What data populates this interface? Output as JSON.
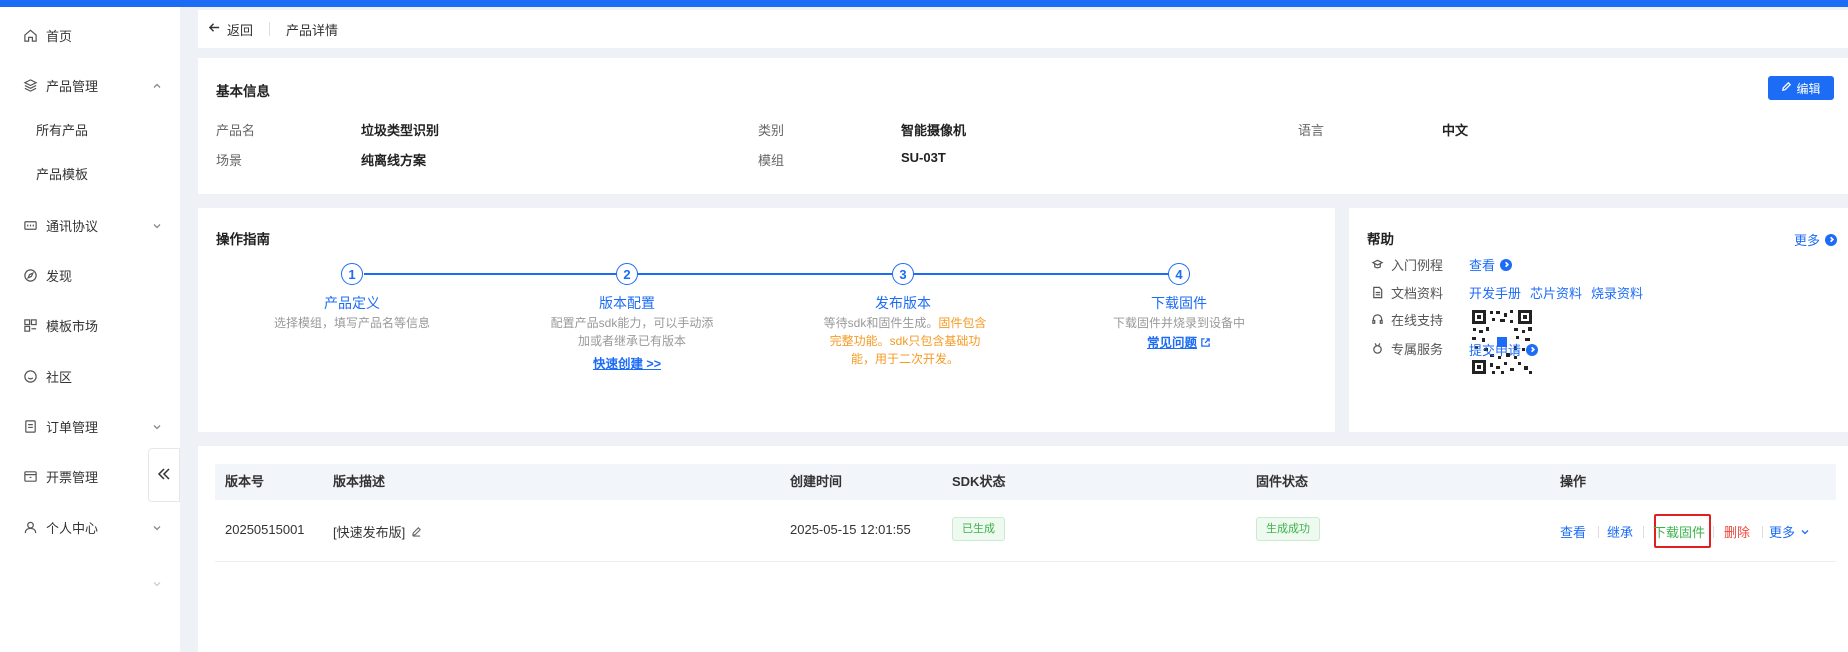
{
  "sidebar": {
    "items": [
      {
        "label": "首页",
        "icon": "home-icon"
      },
      {
        "label": "产品管理",
        "icon": "layers-icon"
      },
      {
        "label": "通讯协议",
        "icon": "protocol-icon"
      },
      {
        "label": "发现",
        "icon": "compass-icon"
      },
      {
        "label": "模板市场",
        "icon": "template-icon"
      },
      {
        "label": "社区",
        "icon": "community-icon"
      },
      {
        "label": "订单管理",
        "icon": "order-icon"
      },
      {
        "label": "开票管理",
        "icon": "invoice-icon"
      },
      {
        "label": "个人中心",
        "icon": "user-icon"
      }
    ],
    "sub_items": [
      "所有产品",
      "产品模板"
    ]
  },
  "header": {
    "back_label": "返回",
    "title": "产品详情"
  },
  "basic_info": {
    "title": "基本信息",
    "edit_label": "编辑",
    "fields": [
      {
        "label": "产品名",
        "value": "垃圾类型识别"
      },
      {
        "label": "类别",
        "value": "智能摄像机"
      },
      {
        "label": "语言",
        "value": "中文"
      },
      {
        "label": "场景",
        "value": "纯离线方案"
      },
      {
        "label": "模组",
        "value": "SU-03T"
      }
    ]
  },
  "guide": {
    "title": "操作指南",
    "steps": [
      {
        "num": "1",
        "title": "产品定义",
        "desc": "选择模组，填写产品名等信息"
      },
      {
        "num": "2",
        "title": "版本配置",
        "desc": "配置产品sdk能力，可以手动添加或者继承已有版本",
        "link": "快速创建 >>"
      },
      {
        "num": "3",
        "title": "发布版本",
        "desc_plain": "等待sdk和固件生成。",
        "desc_orange": "固件包含完整功能。sdk只包含基础功能，用于二次开发。"
      },
      {
        "num": "4",
        "title": "下载固件",
        "desc": "下载固件并烧录到设备中",
        "link": "常见问题"
      }
    ]
  },
  "help": {
    "title": "帮助",
    "more": "更多",
    "rows": [
      {
        "label": "入门例程",
        "links": [
          "查看"
        ]
      },
      {
        "label": "文档资料",
        "links": [
          "开发手册",
          "芯片资料",
          "烧录资料"
        ]
      },
      {
        "label": "在线支持"
      },
      {
        "label": "专属服务",
        "links": [
          "提交申请"
        ]
      }
    ]
  },
  "table": {
    "columns": [
      "版本号",
      "版本描述",
      "创建时间",
      "SDK状态",
      "固件状态",
      "操作"
    ],
    "rows": [
      {
        "version": "20250515001",
        "description": "[快速发布版]",
        "created": "2025-05-15 12:01:55",
        "sdk_status": "已生成",
        "fw_status": "生成成功",
        "ops": [
          "查看",
          "继承",
          "下载固件",
          "删除",
          "更多"
        ]
      }
    ]
  },
  "colors": {
    "accent": "#1c6cf5",
    "success": "#3bb34a",
    "danger": "#f0453a",
    "warning": "#f59a23",
    "highlight_box": "#e02020"
  }
}
